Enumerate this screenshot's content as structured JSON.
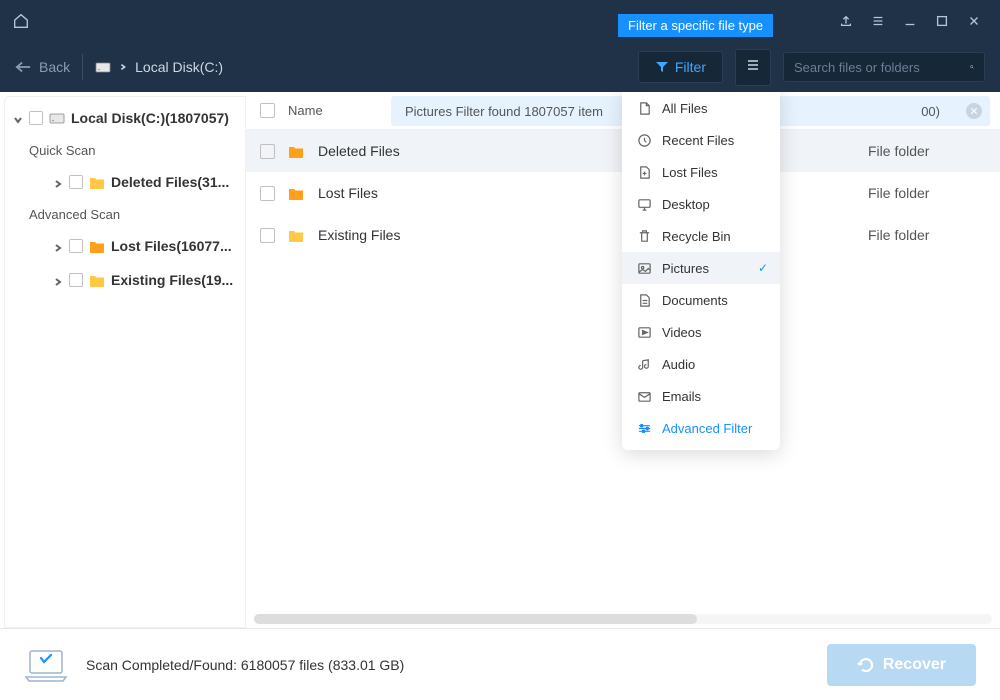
{
  "tooltip": "Filter a specific file type",
  "toolbar": {
    "back_label": "Back",
    "breadcrumb_location": "Local Disk(C:)",
    "filter_label": "Filter"
  },
  "search": {
    "placeholder": "Search files or folders"
  },
  "sidebar": {
    "root": "Local Disk(C:)(1807057)",
    "cat1": "Quick Scan",
    "cat2": "Advanced Scan",
    "items": [
      "Deleted Files(31...",
      "Lost Files(16077...",
      "Existing Files(19..."
    ]
  },
  "notice": {
    "text": "Pictures Filter found 1807057 item",
    "tail": "00)"
  },
  "list": {
    "header_name": "Name",
    "rows": [
      {
        "name": "Deleted Files",
        "type": "File folder",
        "variant": "orange"
      },
      {
        "name": "Lost Files",
        "type": "File folder",
        "variant": "orange"
      },
      {
        "name": "Existing Files",
        "type": "File folder",
        "variant": "yellow"
      }
    ]
  },
  "filter_menu": [
    {
      "label": "All Files",
      "icon": "file"
    },
    {
      "label": "Recent Files",
      "icon": "clock"
    },
    {
      "label": "Lost Files",
      "icon": "lost"
    },
    {
      "label": "Desktop",
      "icon": "desktop"
    },
    {
      "label": "Recycle Bin",
      "icon": "trash"
    },
    {
      "label": "Pictures",
      "icon": "image",
      "selected": true
    },
    {
      "label": "Documents",
      "icon": "doc"
    },
    {
      "label": "Videos",
      "icon": "video"
    },
    {
      "label": "Audio",
      "icon": "audio"
    },
    {
      "label": "Emails",
      "icon": "mail"
    },
    {
      "label": "Advanced Filter",
      "icon": "sliders",
      "advanced": true
    }
  ],
  "footer": {
    "status": "Scan Completed/Found: 6180057 files (833.01 GB)",
    "recover_label": "Recover"
  }
}
